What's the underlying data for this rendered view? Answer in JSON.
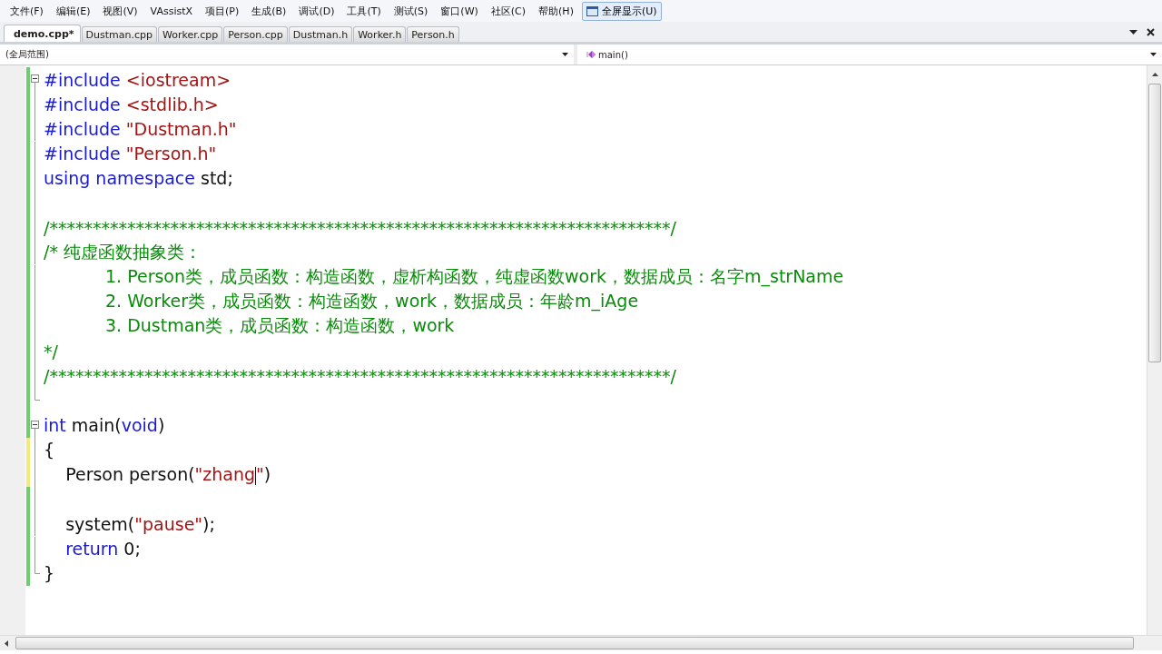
{
  "menu": [
    {
      "label": "文件(F)",
      "kind": "menu"
    },
    {
      "label": "编辑(E)",
      "kind": "menu"
    },
    {
      "label": "视图(V)",
      "kind": "menu"
    },
    {
      "label": "VAssistX",
      "kind": "menu"
    },
    {
      "label": "项目(P)",
      "kind": "menu"
    },
    {
      "label": "生成(B)",
      "kind": "menu"
    },
    {
      "label": "调试(D)",
      "kind": "menu"
    },
    {
      "label": "工具(T)",
      "kind": "menu"
    },
    {
      "label": "测试(S)",
      "kind": "menu"
    },
    {
      "label": "窗口(W)",
      "kind": "menu"
    },
    {
      "label": "社区(C)",
      "kind": "menu"
    },
    {
      "label": "帮助(H)",
      "kind": "menu"
    },
    {
      "label": "全屏显示(U)",
      "kind": "button"
    }
  ],
  "tabs": [
    {
      "label": "demo.cpp*",
      "selected": true
    },
    {
      "label": "Dustman.cpp",
      "selected": false
    },
    {
      "label": "Worker.cpp",
      "selected": false
    },
    {
      "label": "Person.cpp",
      "selected": false
    },
    {
      "label": "Dustman.h",
      "selected": false
    },
    {
      "label": "Worker.h",
      "selected": false
    },
    {
      "label": "Person.h",
      "selected": false
    }
  ],
  "scope": {
    "left": "(全局范围)",
    "right": "main()"
  },
  "lines": [
    {
      "fold_start": true,
      "in_block": false,
      "fold_end": false,
      "unsaved": false,
      "tokens": [
        {
          "kind": "keyword",
          "text": "#include"
        },
        {
          "kind": "string",
          "text": " <iostream>"
        }
      ]
    },
    {
      "fold_start": false,
      "in_block": true,
      "fold_end": false,
      "unsaved": false,
      "tokens": [
        {
          "kind": "keyword",
          "text": "#include"
        },
        {
          "kind": "string",
          "text": " <stdlib.h>"
        }
      ]
    },
    {
      "fold_start": false,
      "in_block": true,
      "fold_end": false,
      "unsaved": false,
      "tokens": [
        {
          "kind": "keyword",
          "text": "#include"
        },
        {
          "kind": "string",
          "text": " \"Dustman.h\""
        }
      ]
    },
    {
      "fold_start": false,
      "in_block": true,
      "fold_end": false,
      "unsaved": false,
      "tokens": [
        {
          "kind": "keyword",
          "text": "#include"
        },
        {
          "kind": "string",
          "text": " \"Person.h\""
        }
      ]
    },
    {
      "fold_start": false,
      "in_block": true,
      "fold_end": false,
      "unsaved": false,
      "tokens": [
        {
          "kind": "keyword",
          "text": "using namespace"
        },
        {
          "kind": "plain",
          "text": " std;"
        }
      ]
    },
    {
      "fold_start": false,
      "in_block": true,
      "fold_end": false,
      "unsaved": false
    },
    {
      "fold_start": false,
      "in_block": true,
      "fold_end": false,
      "unsaved": false,
      "tokens": [
        {
          "kind": "comment",
          "text": "/************************************************************************/"
        }
      ]
    },
    {
      "fold_start": false,
      "in_block": true,
      "fold_end": false,
      "unsaved": false,
      "tokens": [
        {
          "kind": "comment",
          "text": "/* 纯虚函数抽象类："
        }
      ]
    },
    {
      "fold_start": false,
      "in_block": true,
      "fold_end": false,
      "unsaved": false,
      "tokens": [
        {
          "kind": "comment",
          "text": "\t1. Person类，成员函数：构造函数，虚析构函数，纯虚函数work，数据成员：名字m_strName"
        }
      ]
    },
    {
      "fold_start": false,
      "in_block": true,
      "fold_end": false,
      "unsaved": false,
      "tokens": [
        {
          "kind": "comment",
          "text": "\t2. Worker类，成员函数：构造函数，work，数据成员：年龄m_iAge"
        }
      ]
    },
    {
      "fold_start": false,
      "in_block": true,
      "fold_end": false,
      "unsaved": false,
      "tokens": [
        {
          "kind": "comment",
          "text": "\t3. Dustman类，成员函数：构造函数，work"
        }
      ]
    },
    {
      "fold_start": false,
      "in_block": true,
      "fold_end": false,
      "unsaved": false,
      "tokens": [
        {
          "kind": "comment",
          "text": "*/"
        }
      ]
    },
    {
      "fold_start": false,
      "in_block": true,
      "fold_end": false,
      "unsaved": false,
      "tokens": [
        {
          "kind": "comment",
          "text": "/************************************************************************/"
        }
      ]
    },
    {
      "fold_start": false,
      "in_block": false,
      "fold_end": true,
      "unsaved": false
    },
    {
      "fold_start": true,
      "in_block": false,
      "fold_end": false,
      "unsaved": false,
      "tokens": [
        {
          "kind": "keyword",
          "text": "int"
        },
        {
          "kind": "plain",
          "text": " main("
        },
        {
          "kind": "keyword",
          "text": "void"
        },
        {
          "kind": "plain",
          "text": ")"
        }
      ]
    },
    {
      "fold_start": false,
      "in_block": true,
      "fold_end": false,
      "unsaved": true,
      "tokens": [
        {
          "kind": "plain",
          "text": "{"
        }
      ]
    },
    {
      "fold_start": false,
      "in_block": true,
      "fold_end": false,
      "unsaved": true,
      "tokens": [
        {
          "kind": "plain",
          "text": "    Person person("
        },
        {
          "kind": "string",
          "text": "\"zhang"
        },
        {
          "kind": "caret"
        },
        {
          "kind": "string",
          "text": "\""
        },
        {
          "kind": "plain",
          "text": ")"
        }
      ]
    },
    {
      "fold_start": false,
      "in_block": true,
      "fold_end": false,
      "unsaved": false
    },
    {
      "fold_start": false,
      "in_block": true,
      "fold_end": false,
      "unsaved": false,
      "tokens": [
        {
          "kind": "plain",
          "text": "    system("
        },
        {
          "kind": "string",
          "text": "\"pause\""
        },
        {
          "kind": "plain",
          "text": ");"
        }
      ]
    },
    {
      "fold_start": false,
      "in_block": true,
      "fold_end": false,
      "unsaved": false,
      "tokens": [
        {
          "kind": "keyword",
          "text": "    return"
        },
        {
          "kind": "plain",
          "text": " 0;"
        }
      ]
    },
    {
      "fold_start": false,
      "in_block": false,
      "fold_end": true,
      "unsaved": false,
      "tokens": [
        {
          "kind": "plain",
          "text": "}"
        }
      ]
    }
  ]
}
